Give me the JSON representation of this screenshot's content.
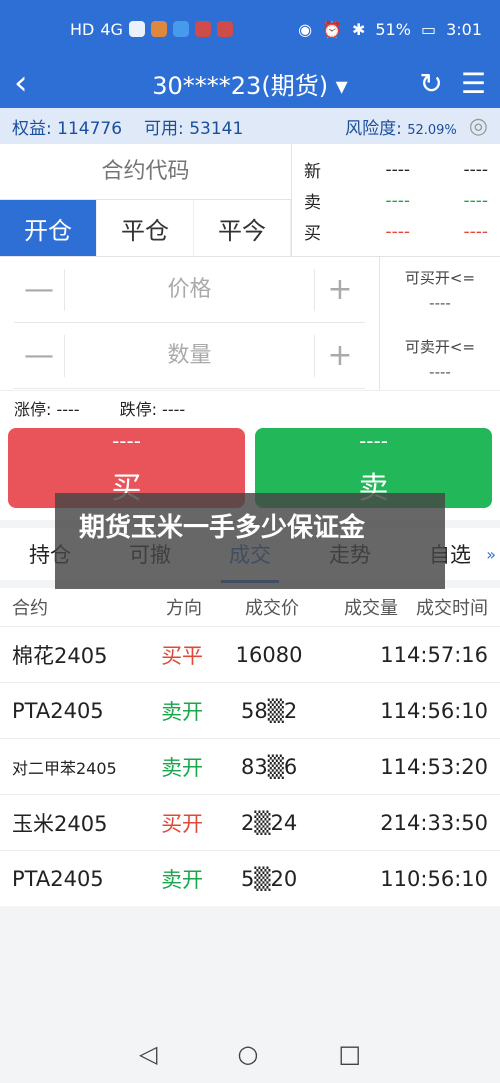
{
  "status": {
    "left_badges": [
      "HD",
      "4G",
      "Wi-Fi"
    ],
    "battery": "51%",
    "time": "3:01"
  },
  "titlebar": {
    "back_icon": "chevron-left-icon",
    "title": "30****23(期货) ▾",
    "refresh_icon": "refresh-icon",
    "menu_icon": "list-menu-icon"
  },
  "account": {
    "equity_label": "权益:",
    "equity_value": "114776",
    "available_label": "可用:",
    "available_value": "53141",
    "risk_label": "风险度:",
    "risk_value": "52.09%"
  },
  "order": {
    "code_placeholder": "合约代码",
    "tabs": [
      "开仓",
      "平仓",
      "平今"
    ],
    "quotes": [
      {
        "label": "新",
        "left": "----",
        "right": "----"
      },
      {
        "label": "卖",
        "left": "----",
        "right": "----"
      },
      {
        "label": "买",
        "left": "----",
        "right": "----"
      }
    ],
    "price_label": "价格",
    "quantity_label": "数量",
    "minus": "—",
    "plus": "+",
    "can_buy_label": "可买开<=",
    "can_buy_value": "----",
    "can_sell_label": "可卖开<=",
    "can_sell_value": "----",
    "limit_up": "涨停: ----",
    "limit_down": "跌停: ----",
    "buy_price": "----",
    "buy_label": "买",
    "sell_price": "----",
    "sell_label": "卖"
  },
  "nav_tabs": [
    "持仓",
    "可撤",
    "成交",
    "走势",
    "自选"
  ],
  "nav_more": "»",
  "table": {
    "headers": [
      "合约",
      "方向",
      "成交价",
      "成交量",
      "成交时间"
    ],
    "rows": [
      {
        "name": "棉花2405",
        "dir": "买平",
        "price": "16080",
        "qty": "1",
        "time": "14:57:16"
      },
      {
        "name": "PTA2405",
        "dir": "卖开",
        "price": "58▒2",
        "qty": "1",
        "time": "14:56:10"
      },
      {
        "name": "对二甲苯2405",
        "dir": "卖开",
        "price": "83▒6",
        "qty": "1",
        "time": "14:53:20"
      },
      {
        "name": "玉米2405",
        "dir": "买开",
        "price": "2▒24",
        "qty": "2",
        "time": "14:33:50"
      },
      {
        "name": "PTA2405",
        "dir": "卖开",
        "price": "5▒20",
        "qty": "1",
        "time": "10:56:10"
      }
    ]
  },
  "overlay_text": "期货玉米一手多少保证金",
  "navbar": {
    "back": "◁",
    "home": "○",
    "recent": "□"
  }
}
